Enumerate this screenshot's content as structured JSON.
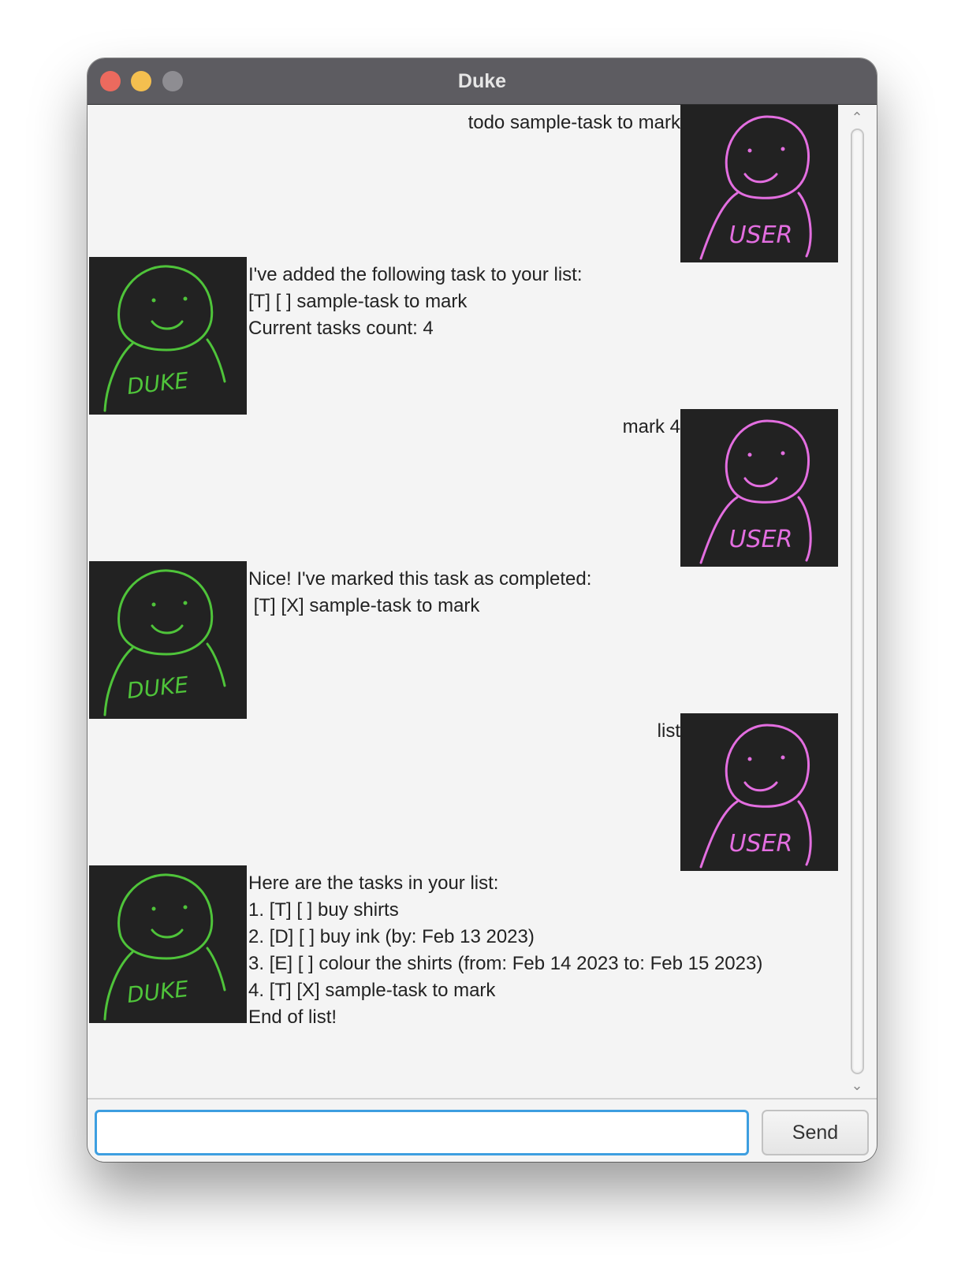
{
  "window": {
    "title": "Duke"
  },
  "dialog": [
    {
      "speaker": "user",
      "text": "todo sample-task to mark",
      "avatar_label": "USER"
    },
    {
      "speaker": "duke",
      "text": "I've added the following task to your list:\n[T] [ ] sample-task to mark\nCurrent tasks count: 4",
      "avatar_label": "DUKE"
    },
    {
      "speaker": "user",
      "text": "mark 4",
      "avatar_label": "USER"
    },
    {
      "speaker": "duke",
      "text": "Nice! I've marked this task as completed:\n [T] [X] sample-task to mark",
      "avatar_label": "DUKE"
    },
    {
      "speaker": "user",
      "text": "list",
      "avatar_label": "USER"
    },
    {
      "speaker": "duke",
      "text": "Here are the tasks in your list:\n1. [T] [ ] buy shirts\n2. [D] [ ] buy ink (by: Feb 13 2023)\n3. [E] [ ] colour the shirts (from: Feb 14 2023 to: Feb 15 2023)\n4. [T] [X] sample-task to mark\nEnd of list!",
      "avatar_label": "DUKE"
    }
  ],
  "input": {
    "value": "",
    "placeholder": ""
  },
  "send_button": {
    "label": "Send"
  },
  "colors": {
    "user_avatar_stroke": "#e36ee0",
    "duke_avatar_stroke": "#4fc43a",
    "avatar_bg": "#222222",
    "input_focus": "#3d9ee0"
  }
}
